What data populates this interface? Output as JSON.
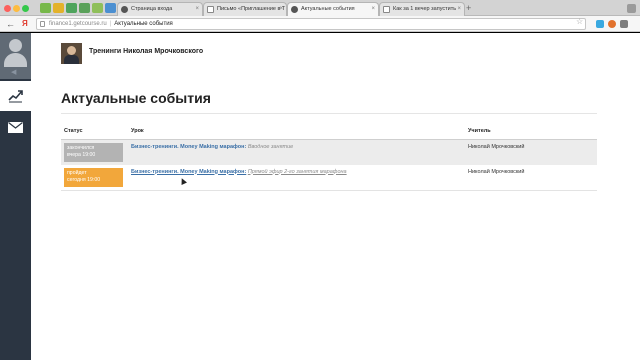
{
  "browser": {
    "tabs": [
      {
        "label": "Страница входа"
      },
      {
        "label": "Письмо «Приглашение в Т"
      },
      {
        "label": "Актуальные события"
      },
      {
        "label": "Как за 1 вечер запустить"
      }
    ],
    "url_host": "finance1.getcourse.ru",
    "url_title": "Актуальные события"
  },
  "header": {
    "brand_name": "Тренинги Николая Мрочковского"
  },
  "main": {
    "title": "Актуальные события",
    "table": {
      "columns": [
        "Статус",
        "Урок",
        "Учитель"
      ],
      "rows": [
        {
          "status_line1": "закончился",
          "status_line2": "вчера 19:00",
          "lesson_link": "Бизнес-тренинги. Money Making марафон:",
          "lesson_sub": "Вводное занятие",
          "teacher": "Николай Мрочковский"
        },
        {
          "status_line1": "пройдет",
          "status_line2": "сегодня 19:00",
          "lesson_link": "Бизнес-тренинги. Money Making марафон:",
          "lesson_sub": "Прямой эфир 2-го занятия марафона",
          "teacher": "Николай Мрочковский"
        }
      ]
    }
  },
  "colors": {
    "sidebar": "#2b3542",
    "status_past": "#b3b3b3",
    "status_future": "#f2a73b",
    "link": "#3a6fa6"
  },
  "icons": [
    "back-icon",
    "forward-icon",
    "reload-icon",
    "star-icon",
    "avatar-icon",
    "chart-icon",
    "mail-icon"
  ]
}
